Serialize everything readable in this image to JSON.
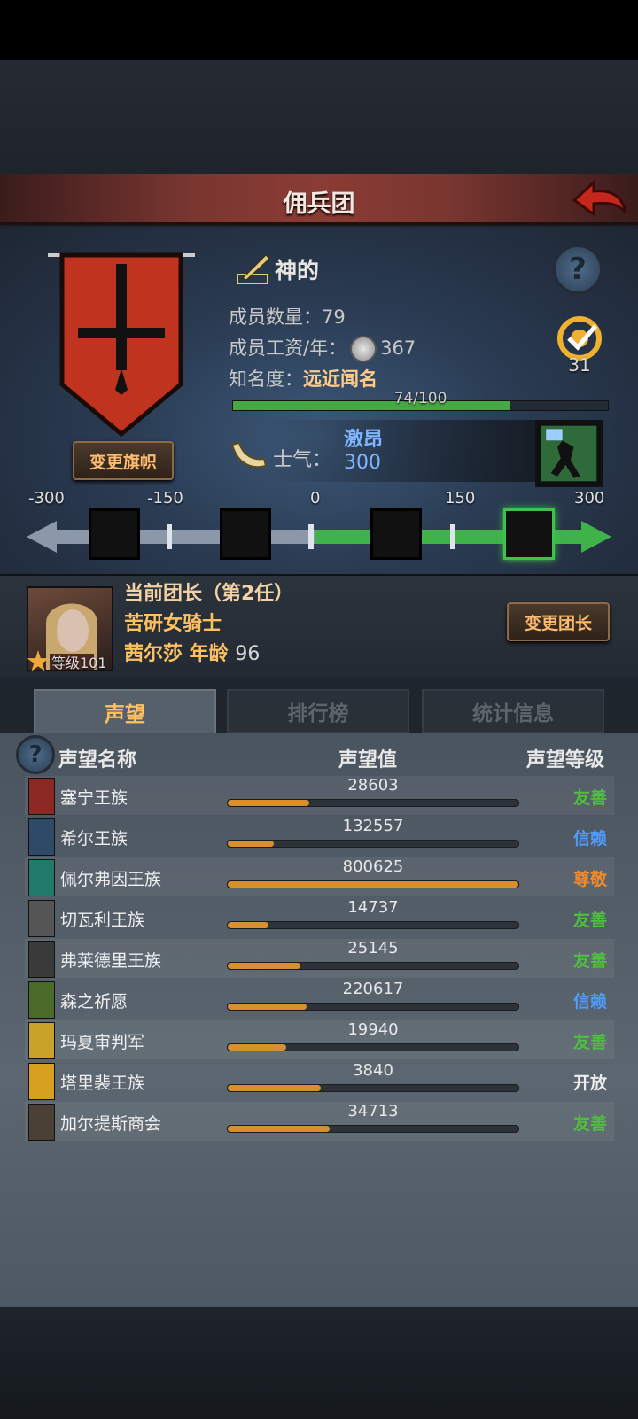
{
  "header": {
    "title": "佣兵团"
  },
  "company": {
    "name": "神的",
    "members_label": "成员数量：",
    "members": "79",
    "wage_label": "成员工资/年：",
    "wage": "367",
    "fame_label": "知名度：",
    "fame_value": "远近闻名",
    "fame_progress": "74/100",
    "fame_fraction": 0.74,
    "target_count": "31",
    "change_banner_label": "变更旗帜"
  },
  "morale": {
    "label": "士气：",
    "state": "激昂",
    "value": "300",
    "scale_labels": [
      "-300",
      "-150",
      "0",
      "150",
      "300"
    ]
  },
  "leader": {
    "title": "当前团长（第2任）",
    "class_name": "苦研女骑士",
    "name_age": "茜尔莎  年龄",
    "age": "96",
    "level": "等级101",
    "change_leader_label": "变更团长"
  },
  "tabs": [
    {
      "label": "声望",
      "active": true
    },
    {
      "label": "排行榜",
      "active": false
    },
    {
      "label": "统计信息",
      "active": false
    }
  ],
  "reputation": {
    "col_name": "声望名称",
    "col_value": "声望值",
    "col_level": "声望等级",
    "rows": [
      {
        "name": "塞宁王族",
        "value": "28603",
        "fill": 0.28,
        "level": "友善",
        "level_color": "#4fbf3e",
        "icon_color": "#8a2a22"
      },
      {
        "name": "希尔王族",
        "value": "132557",
        "fill": 0.16,
        "level": "信赖",
        "level_color": "#4f9bff",
        "icon_color": "#2e4a66"
      },
      {
        "name": "佩尔弗因王族",
        "value": "800625",
        "fill": 1.0,
        "level": "尊敬",
        "level_color": "#f08a2a",
        "icon_color": "#1f7a6a"
      },
      {
        "name": "切瓦利王族",
        "value": "14737",
        "fill": 0.14,
        "level": "友善",
        "level_color": "#4fbf3e",
        "icon_color": "#555555"
      },
      {
        "name": "弗莱德里王族",
        "value": "25145",
        "fill": 0.25,
        "level": "友善",
        "level_color": "#4fbf3e",
        "icon_color": "#3a3a3a"
      },
      {
        "name": "森之祈愿",
        "value": "220617",
        "fill": 0.27,
        "level": "信赖",
        "level_color": "#4f9bff",
        "icon_color": "#4a6a2a"
      },
      {
        "name": "玛夏审判军",
        "value": "19940",
        "fill": 0.2,
        "level": "友善",
        "level_color": "#4fbf3e",
        "icon_color": "#c9a22a"
      },
      {
        "name": "塔里裴王族",
        "value": "3840",
        "fill": 0.32,
        "level": "开放",
        "level_color": "#eeeeee",
        "icon_color": "#d8a020"
      },
      {
        "name": "加尔提斯商会",
        "value": "34713",
        "fill": 0.35,
        "level": "友善",
        "level_color": "#4fbf3e",
        "icon_color": "#4a4036"
      }
    ]
  },
  "icons": {
    "back": "back-arrow-icon",
    "help": "question-icon",
    "edit": "quill-icon",
    "coin": "silver-coin-icon",
    "target": "target-icon",
    "horn": "horn-icon",
    "morale": "charging-soldier-icon"
  },
  "colors": {
    "accent_gold": "#ffbc6e",
    "morale_blue": "#7eb6ff",
    "bar_green": "#45a845",
    "rep_bar": "#d8902e"
  }
}
